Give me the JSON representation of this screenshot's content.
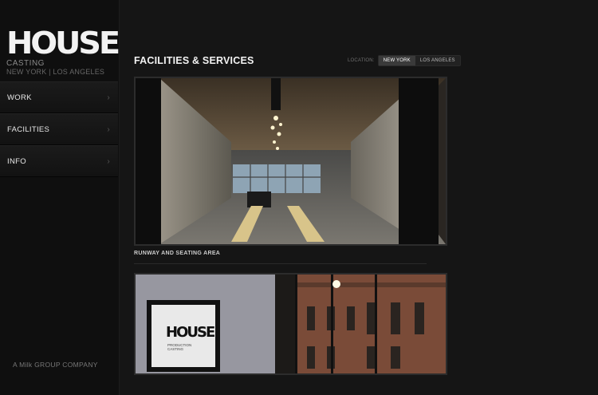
{
  "brand": {
    "logo_text": "HOUSE",
    "tagline": "CASTING",
    "locations": "NEW YORK | LOS ANGELES",
    "footer": "A Milk GROUP COMPANY"
  },
  "nav": {
    "items": [
      {
        "label": "WORK"
      },
      {
        "label": "FACILITIES"
      },
      {
        "label": "INFO"
      }
    ]
  },
  "main": {
    "title": "FACILITIES & SERVICES",
    "location_label": "LOCATION:",
    "locations": [
      {
        "label": "NEW YORK",
        "active": true
      },
      {
        "label": "LOS ANGELES",
        "active": false
      }
    ],
    "photos": [
      {
        "caption": "RUNWAY AND SEATING AREA"
      },
      {
        "screen_text": "HOUSE",
        "screen_subtext": "PRODUCTION CASTING"
      }
    ]
  }
}
